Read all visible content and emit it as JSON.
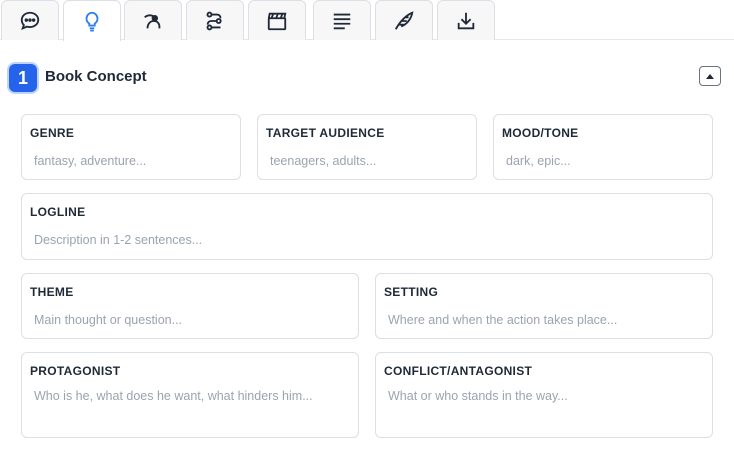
{
  "tabs": [
    {
      "name": "tab-chat",
      "icon": "speech-bubble-icon",
      "active": false
    },
    {
      "name": "tab-concept",
      "icon": "lightbulb-icon",
      "active": true
    },
    {
      "name": "tab-characters",
      "icon": "character-icon",
      "active": false
    },
    {
      "name": "tab-plot",
      "icon": "plot-nodes-icon",
      "active": false
    },
    {
      "name": "tab-scenes",
      "icon": "clapperboard-icon",
      "active": false
    },
    {
      "name": "tab-text",
      "icon": "text-lines-icon",
      "active": false
    },
    {
      "name": "tab-writing",
      "icon": "quill-icon",
      "active": false
    },
    {
      "name": "tab-export",
      "icon": "download-icon",
      "active": false
    }
  ],
  "section": {
    "step": "1",
    "title": "Book Concept"
  },
  "fields": {
    "genre": {
      "label": "GENRE",
      "placeholder": "fantasy, adventure..."
    },
    "audience": {
      "label": "TARGET AUDIENCE",
      "placeholder": "teenagers, adults..."
    },
    "mood": {
      "label": "MOOD/TONE",
      "placeholder": "dark, epic..."
    },
    "logline": {
      "label": "LOGLINE",
      "placeholder": "Description in 1-2 sentences..."
    },
    "theme": {
      "label": "THEME",
      "placeholder": "Main thought or question..."
    },
    "setting": {
      "label": "SETTING",
      "placeholder": "Where and when the action takes place..."
    },
    "protagonist": {
      "label": "PROTAGONIST",
      "placeholder": "Who is he, what does he want, what hinders him..."
    },
    "conflict": {
      "label": "CONFLICT/ANTAGONIST",
      "placeholder": "What or who stands in the way..."
    }
  },
  "colors": {
    "accent": "#2563eb",
    "active_icon": "#2f80ed"
  }
}
